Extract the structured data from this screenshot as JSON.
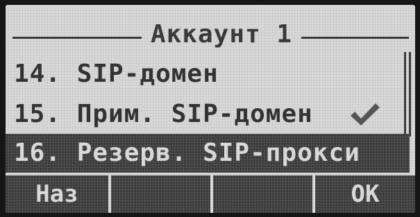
{
  "screen": {
    "title": "Аккаунт 1",
    "menu_items": [
      {
        "label": "14. SIP-домен",
        "checked": false,
        "selected": false
      },
      {
        "label": "15. Прим. SIP-домен",
        "checked": true,
        "selected": false
      },
      {
        "label": "16. Резерв. SIP-прокси",
        "checked": false,
        "selected": true
      }
    ],
    "check_icon": "checkmark-icon"
  },
  "softkeys": [
    {
      "label": "Наз"
    },
    {
      "label": ""
    },
    {
      "label": ""
    },
    {
      "label": "ОК"
    }
  ],
  "colors": {
    "lcd_background": "#d9d9d9",
    "lcd_ink": "#3a3a3a",
    "bezel": "#161616"
  }
}
